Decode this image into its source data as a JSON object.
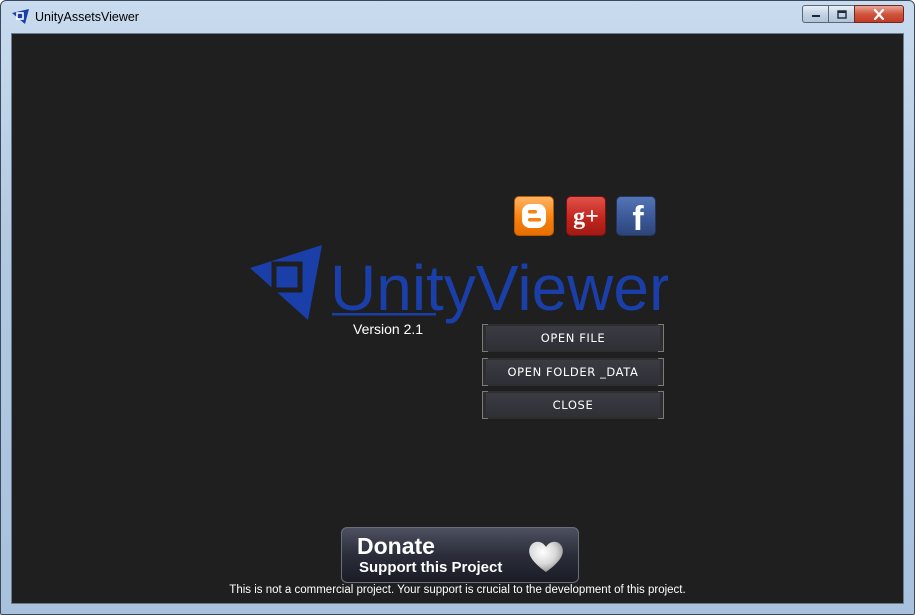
{
  "window": {
    "title": "UnityAssetsViewer"
  },
  "social": {
    "blogger_letter": "B",
    "gplus_label": "g+",
    "facebook_letter": "f"
  },
  "logo": {
    "brand": "UnityViewer"
  },
  "version": "Version 2.1",
  "menu": {
    "open_file": "OPEN FILE",
    "open_folder": "OPEN FOLDER _DATA",
    "close": "CLOSE"
  },
  "donate": {
    "title": "Donate",
    "subtitle": "Support this Project"
  },
  "footer_note": "This is not a commercial project. Your support is crucial to the development of this project.",
  "colors": {
    "background": "#1f1f1f",
    "logo_blue": "#1a3fa8",
    "menu_button": "#33333b"
  }
}
